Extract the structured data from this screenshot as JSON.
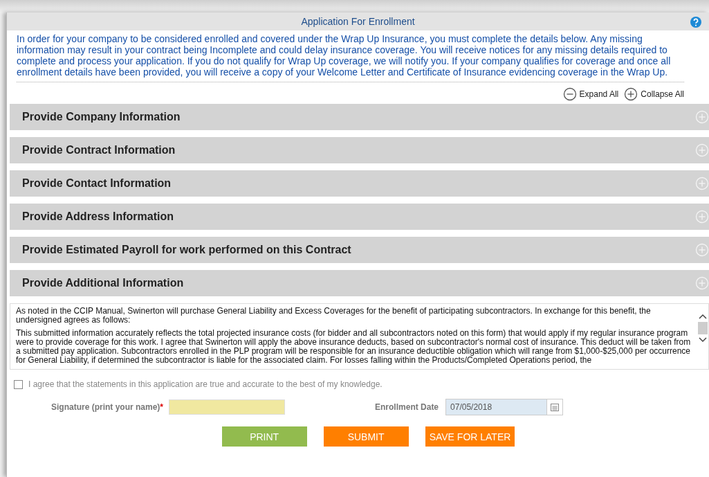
{
  "window": {
    "title": "Application For Enrollment"
  },
  "intro": "In order for your company to be considered enrolled and covered under the Wrap Up Insurance, you must complete the details below. Any missing information may result in your contract being Incomplete and could delay insurance coverage. You will receive notices for any missing details required to complete and process your application. If you do not qualify for Wrap Up coverage, we will notify you. If your company qualifies for coverage and once all enrollment details have been provided, you will receive a copy of your Welcome Letter and Certificate of Insurance evidencing coverage in the Wrap Up.",
  "toolbar": [
    {
      "kind": "minus",
      "label": "Expand All"
    },
    {
      "kind": "plus",
      "label": "Collapse All"
    }
  ],
  "sections": [
    {
      "title": "Provide Company Information",
      "expanded": false
    },
    {
      "title": "Provide Contract Information",
      "expanded": false
    },
    {
      "title": "Provide Contact Information",
      "expanded": false
    },
    {
      "title": "Provide Address Information",
      "expanded": false
    },
    {
      "title": "Provide Estimated Payroll for work performed on this Contract",
      "expanded": false
    },
    {
      "title": "Provide Additional Information",
      "expanded": false
    }
  ],
  "terms": [
    "As noted in the CCIP Manual, Swinerton will purchase General Liability and Excess Coverages for the benefit of participating subcontractors. In exchange for this benefit, the undersigned agrees as follows:",
    "This submitted information accurately reflects the total projected insurance costs (for bidder and all subcontractors noted on this form) that would apply if my regular insurance program were to provide coverage for this work. I agree that Swinerton will apply the above insurance deducts, based on subcontractor's normal cost of insurance. This deduct will be taken from a submitted pay application. Subcontractors enrolled in the PLP program will be responsible for an insurance deductible obligation which will range from $1,000-$25,000 per occurrence for General Liability, if determined the subcontractor is liable for the associated claim. For losses falling within the Products/Completed Operations period, the"
  ],
  "agree": {
    "label": "I agree that the statements in this application are true and accurate to the best of my knowledge.",
    "checked": false
  },
  "signature": {
    "label": "Signature (print your name)",
    "required_mark": "*"
  },
  "enrollment_date": {
    "label": "Enrollment Date",
    "value": "07/05/2018"
  },
  "buttons": [
    {
      "label": "PRINT",
      "color": "#92bb4e"
    },
    {
      "label": "SUBMIT",
      "color": "#ff7f00"
    },
    {
      "label": "SAVE FOR LATER",
      "color": "#ff7f00"
    }
  ]
}
